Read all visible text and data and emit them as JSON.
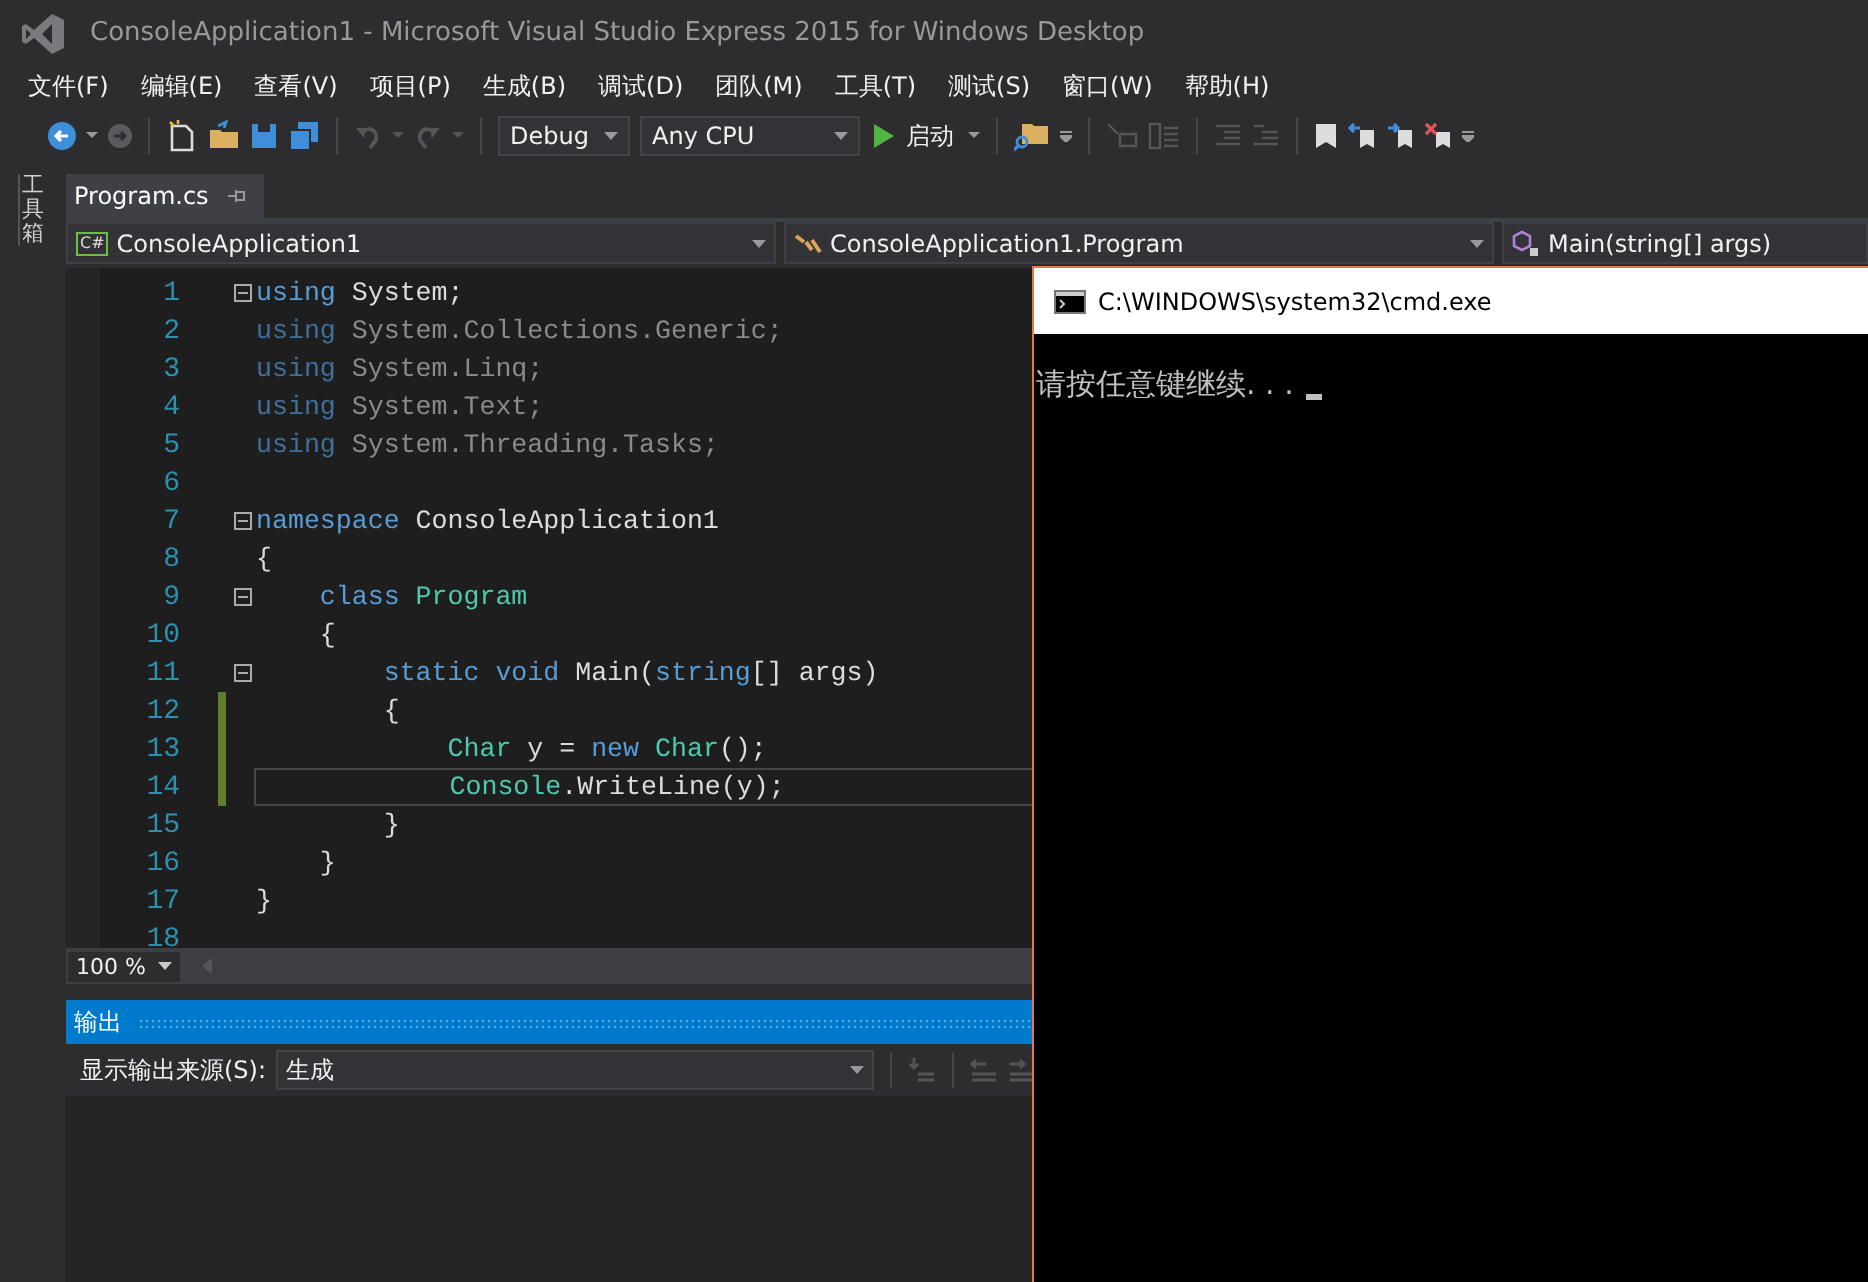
{
  "window": {
    "title": "ConsoleApplication1 - Microsoft Visual Studio Express 2015 for Windows Desktop"
  },
  "menu": [
    "文件(F)",
    "编辑(E)",
    "查看(V)",
    "项目(P)",
    "生成(B)",
    "调试(D)",
    "团队(M)",
    "工具(T)",
    "测试(S)",
    "窗口(W)",
    "帮助(H)"
  ],
  "toolbar": {
    "configuration": "Debug",
    "platform": "Any CPU",
    "start": "启动"
  },
  "side_tab": "工具箱",
  "tabs": [
    {
      "label": "Program.cs",
      "selected": true
    }
  ],
  "nav": {
    "project_badge": "C#",
    "project": "ConsoleApplication1",
    "type": "ConsoleApplication1.Program",
    "member": "Main(string[] args)"
  },
  "editor": {
    "lines": [
      {
        "number": "1",
        "fold": true,
        "changed": false,
        "current": false,
        "tokens": [
          {
            "kind": "keyword",
            "text": "using"
          },
          {
            "kind": "plain",
            "text": " System;"
          }
        ]
      },
      {
        "number": "2",
        "fold": false,
        "changed": false,
        "current": false,
        "tokens": [
          {
            "kind": "dim-keyword",
            "text": "using"
          },
          {
            "kind": "dim",
            "text": " System.Collections.Generic;"
          }
        ]
      },
      {
        "number": "3",
        "fold": false,
        "changed": false,
        "current": false,
        "tokens": [
          {
            "kind": "dim-keyword",
            "text": "using"
          },
          {
            "kind": "dim",
            "text": " System.Linq;"
          }
        ]
      },
      {
        "number": "4",
        "fold": false,
        "changed": false,
        "current": false,
        "tokens": [
          {
            "kind": "dim-keyword",
            "text": "using"
          },
          {
            "kind": "dim",
            "text": " System.Text;"
          }
        ]
      },
      {
        "number": "5",
        "fold": false,
        "changed": false,
        "current": false,
        "tokens": [
          {
            "kind": "dim-keyword",
            "text": "using"
          },
          {
            "kind": "dim",
            "text": " System.Threading.Tasks;"
          }
        ]
      },
      {
        "number": "6",
        "fold": false,
        "changed": false,
        "current": false
      },
      {
        "number": "7",
        "fold": true,
        "changed": false,
        "current": false,
        "tokens": [
          {
            "kind": "keyword",
            "text": "namespace"
          },
          {
            "kind": "plain",
            "text": " ConsoleApplication1"
          }
        ]
      },
      {
        "number": "8",
        "fold": false,
        "changed": false,
        "current": false,
        "tokens": [
          {
            "kind": "plain",
            "text": "{"
          }
        ]
      },
      {
        "number": "9",
        "fold": true,
        "changed": false,
        "current": false,
        "tokens": [
          {
            "kind": "keyword",
            "text": "    class"
          },
          {
            "kind": "type",
            "text": " Program"
          }
        ]
      },
      {
        "number": "10",
        "fold": false,
        "changed": false,
        "current": false,
        "tokens": [
          {
            "kind": "plain",
            "text": "    {"
          }
        ]
      },
      {
        "number": "11",
        "fold": true,
        "changed": false,
        "current": false,
        "tokens": [
          {
            "kind": "keyword",
            "text": "        static void"
          },
          {
            "kind": "plain",
            "text": " Main("
          },
          {
            "kind": "keyword",
            "text": "string"
          },
          {
            "kind": "plain",
            "text": "[] args)"
          }
        ]
      },
      {
        "number": "12",
        "fold": false,
        "changed": true,
        "current": false,
        "tokens": [
          {
            "kind": "plain",
            "text": "        {"
          }
        ]
      },
      {
        "number": "13",
        "fold": false,
        "changed": true,
        "current": false,
        "tokens": [
          {
            "kind": "type",
            "text": "            Char"
          },
          {
            "kind": "plain",
            "text": " y = "
          },
          {
            "kind": "keyword",
            "text": "new"
          },
          {
            "kind": "type",
            "text": " Char"
          },
          {
            "kind": "plain",
            "text": "();"
          }
        ]
      },
      {
        "number": "14",
        "fold": false,
        "changed": true,
        "current": true,
        "tokens": [
          {
            "kind": "type",
            "text": "            Console"
          },
          {
            "kind": "plain",
            "text": ".WriteLine(y);"
          }
        ]
      },
      {
        "number": "15",
        "fold": false,
        "changed": false,
        "current": false,
        "tokens": [
          {
            "kind": "plain",
            "text": "        }"
          }
        ]
      },
      {
        "number": "16",
        "fold": false,
        "changed": false,
        "current": false,
        "tokens": [
          {
            "kind": "plain",
            "text": "    }"
          }
        ]
      },
      {
        "number": "17",
        "fold": false,
        "changed": false,
        "current": false,
        "tokens": [
          {
            "kind": "plain",
            "text": "}"
          }
        ]
      },
      {
        "number": "18",
        "fold": false,
        "changed": false,
        "current": false
      }
    ],
    "zoom": "100 %"
  },
  "output": {
    "title": "输出",
    "source_label": "显示输出来源(S):",
    "source": "生成"
  },
  "console": {
    "title": "C:\\WINDOWS\\system32\\cmd.exe",
    "text": "请按任意键继续. . ."
  }
}
